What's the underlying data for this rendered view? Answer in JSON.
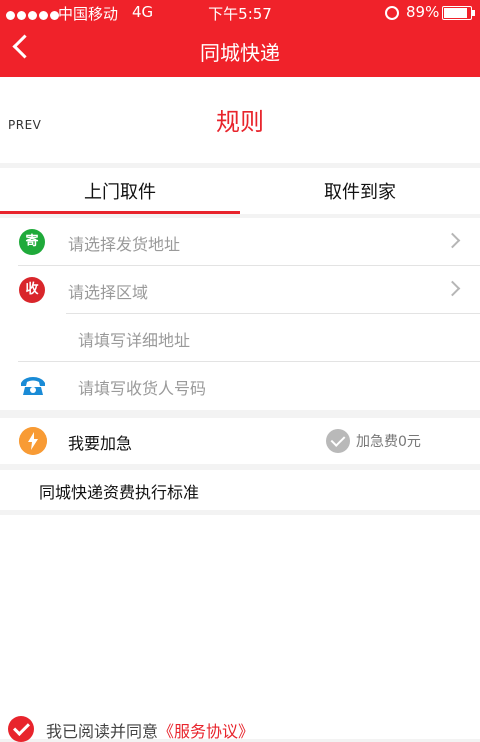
{
  "status": {
    "carrier": "中国移动",
    "network": "4G",
    "time": "下午5:57",
    "battery": "89%"
  },
  "nav": {
    "title": "同城快递"
  },
  "rule_section": {
    "prev": "PREV",
    "title": "规则"
  },
  "tabs": [
    {
      "label": "上门取件",
      "active": true
    },
    {
      "label": "取件到家",
      "active": false
    }
  ],
  "form": {
    "send": {
      "badge": "寄",
      "placeholder": "请选择发货地址"
    },
    "receive": {
      "badge": "收",
      "placeholder": "请选择区域"
    },
    "detail": {
      "placeholder": "请填写详细地址"
    },
    "phone": {
      "placeholder": "请填写收货人号码"
    }
  },
  "urgent": {
    "label": "我要加急",
    "fee": "加急费0元"
  },
  "standard": {
    "label": "同城快递资费执行标准"
  },
  "agreement": {
    "prefix": "我已阅读并同意",
    "link": "《服务协议》"
  },
  "colors": {
    "brand": "#f0222a",
    "accent": "#e8242c",
    "send_badge": "#1faa3a",
    "receive_badge": "#d9262b",
    "urgent_icon": "#f89b35",
    "phone_icon": "#1a8bd6"
  }
}
